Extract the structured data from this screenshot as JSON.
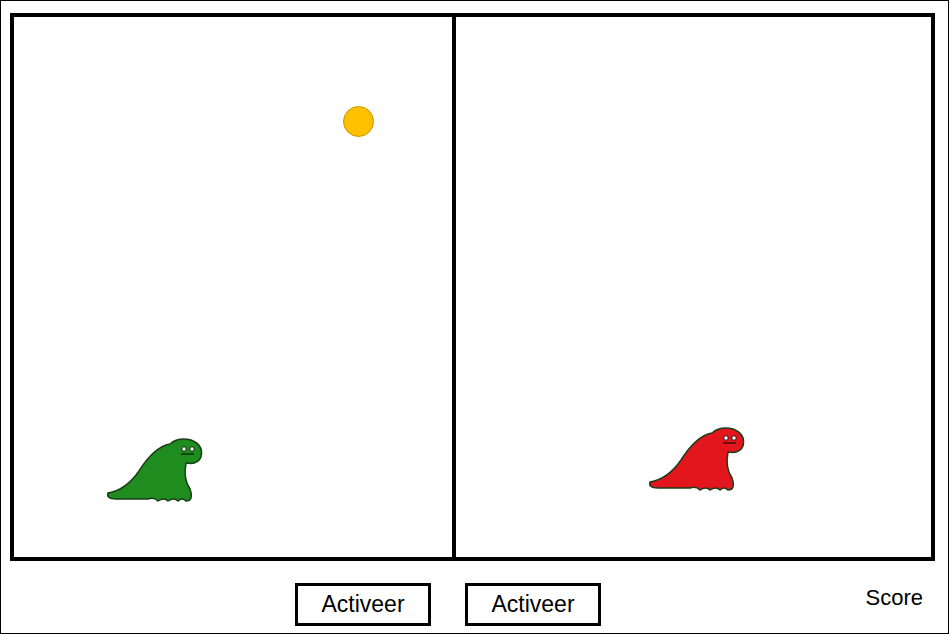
{
  "panels": [
    {
      "player": {
        "color": "#1e8c1e"
      },
      "has_ball": true
    },
    {
      "player": {
        "color": "#e3161e"
      },
      "has_ball": false
    }
  ],
  "buttons": [
    {
      "label": "Activeer"
    },
    {
      "label": "Activeer"
    }
  ],
  "score": {
    "label": "Score"
  }
}
